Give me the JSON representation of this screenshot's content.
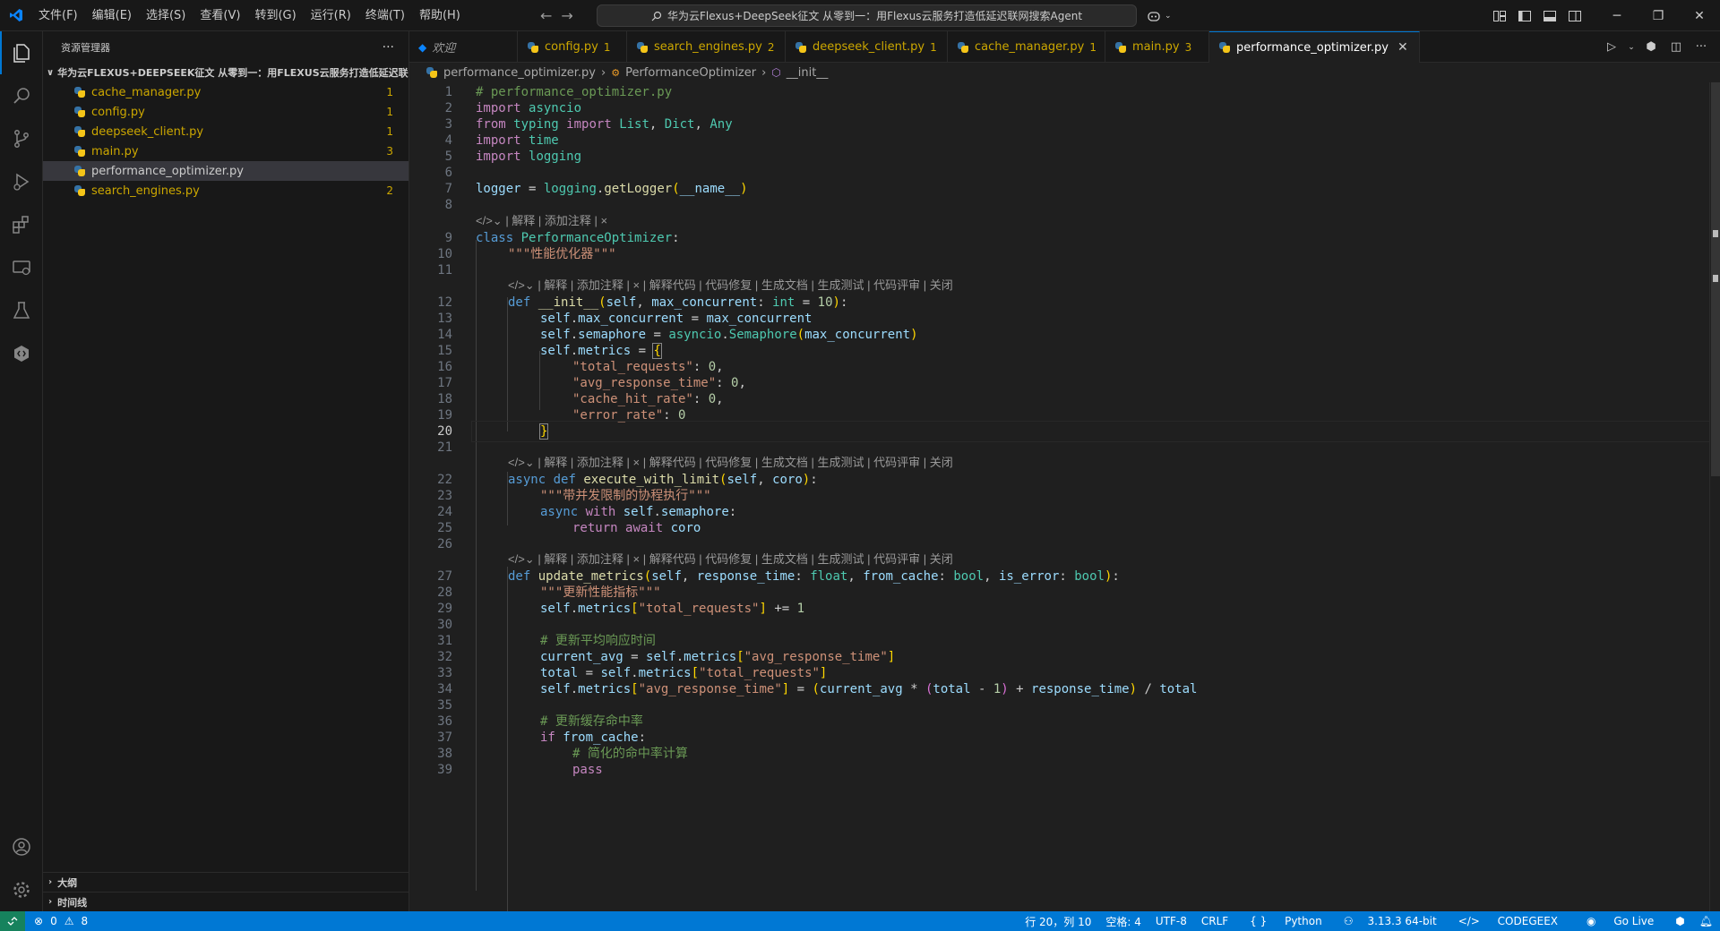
{
  "titlebar": {
    "menu": [
      "文件(F)",
      "编辑(E)",
      "选择(S)",
      "查看(V)",
      "转到(G)",
      "运行(R)",
      "终端(T)",
      "帮助(H)"
    ],
    "search": "华为云Flexus+DeepSeek征文 从零到一：用Flexus云服务打造低延迟联网搜索Agent"
  },
  "sidebar": {
    "title": "资源管理器",
    "folder": "华为云FLEXUS+DEEPSEEK征文 从零到一：用FLEXUS云服务打造低延迟联网...",
    "files": [
      {
        "name": "cache_manager.py",
        "count": "1"
      },
      {
        "name": "config.py",
        "count": "1"
      },
      {
        "name": "deepseek_client.py",
        "count": "1"
      },
      {
        "name": "main.py",
        "count": "3"
      },
      {
        "name": "performance_optimizer.py",
        "count": ""
      },
      {
        "name": "search_engines.py",
        "count": "2"
      }
    ],
    "outline": "大纲",
    "timeline": "时间线"
  },
  "tabs": [
    {
      "label": "欢迎",
      "badge": ""
    },
    {
      "label": "config.py",
      "badge": "1"
    },
    {
      "label": "search_engines.py",
      "badge": "2"
    },
    {
      "label": "deepseek_client.py",
      "badge": "1"
    },
    {
      "label": "cache_manager.py",
      "badge": "1"
    },
    {
      "label": "main.py",
      "badge": "3"
    },
    {
      "label": "performance_optimizer.py",
      "badge": ""
    }
  ],
  "breadcrumb": {
    "file": "performance_optimizer.py",
    "class": "PerformanceOptimizer",
    "method": "__init__"
  },
  "codelens": {
    "short": "| 解释 | 添加注释 | ×",
    "full": "| 解释 | 添加注释 | × | 解释代码 | 代码修复 | 生成文档 | 生成测试 | 代码评审 | 关闭"
  },
  "code": {
    "l1": "# performance_optimizer.py",
    "l10": "\"\"\"性能优化器\"\"\"",
    "l23": "\"\"\"带并发限制的协程执行\"\"\"",
    "l28": "\"\"\"更新性能指标\"\"\"",
    "l31": "# 更新平均响应时间",
    "l36": "# 更新缓存命中率",
    "l38": "# 简化的命中率计算"
  },
  "statusbar": {
    "errors": "0",
    "warnings": "8",
    "position": "行 20，列 10",
    "spaces": "空格: 4",
    "encoding": "UTF-8",
    "eol": "CRLF",
    "language": "Python",
    "interpreter": "3.13.3 64-bit",
    "codegeex": "CODEGEEX",
    "golive": "Go Live"
  },
  "colors": {
    "accent": "#0078d4",
    "warning": "#cca700",
    "statusbar": "#0078d4"
  }
}
